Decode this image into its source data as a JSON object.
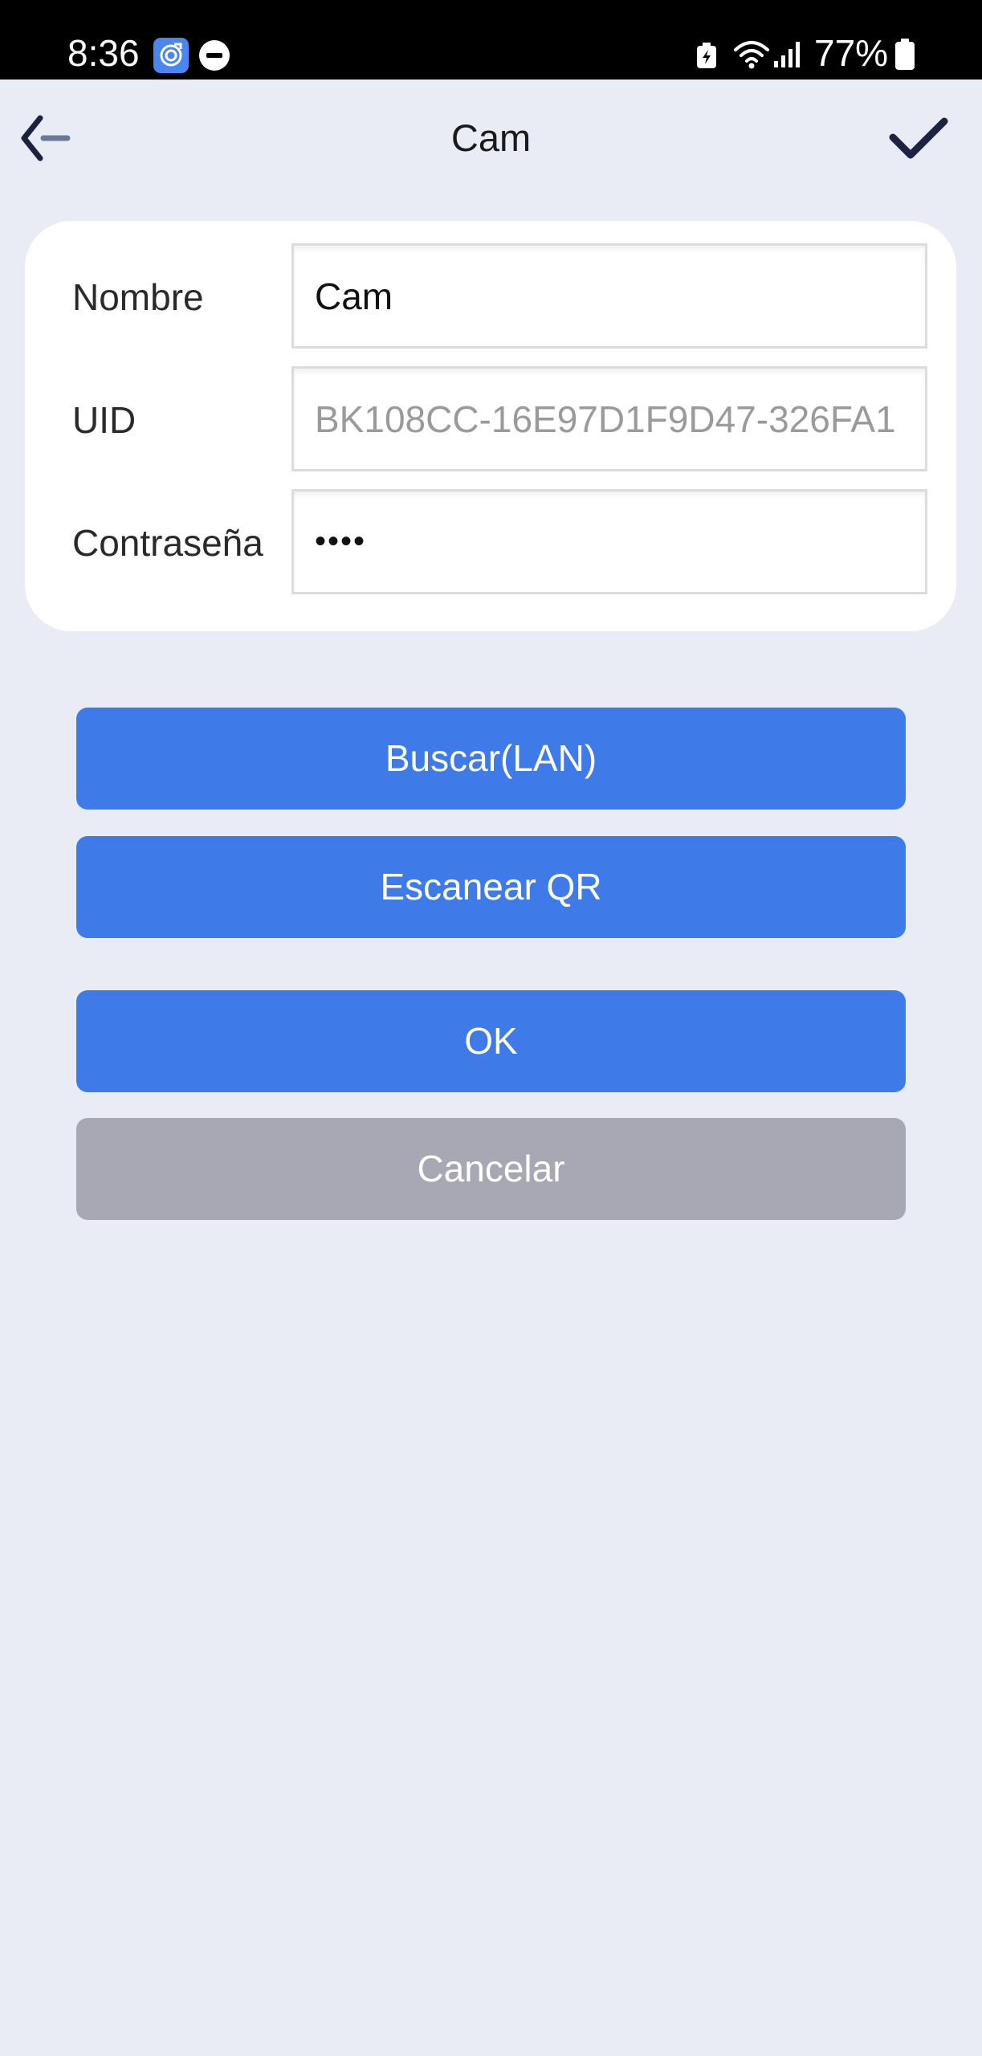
{
  "status_bar": {
    "time": "8:36",
    "battery_percent": "77%",
    "icons": [
      "app-notification-icon",
      "do-not-disturb-icon",
      "battery-saver-icon",
      "wifi-icon",
      "signal-icon",
      "battery-icon"
    ]
  },
  "header": {
    "title": "Cam",
    "back_icon": "arrow-left-icon",
    "confirm_icon": "checkmark-icon"
  },
  "form": {
    "name_label": "Nombre",
    "name_value": "Cam",
    "uid_label": "UID",
    "uid_value": "BK108CC-16E97D1F9D47-326FA1",
    "password_label": "Contraseña",
    "password_value": "••••"
  },
  "buttons": {
    "search_lan": "Buscar(LAN)",
    "scan_qr": "Escanear QR",
    "ok": "OK",
    "cancel": "Cancelar"
  },
  "colors": {
    "background": "#e9ecf5",
    "primary": "#3e7be8",
    "secondary": "#a7a8b3",
    "status_bar": "#000000",
    "header_icon": "#1c2340"
  }
}
